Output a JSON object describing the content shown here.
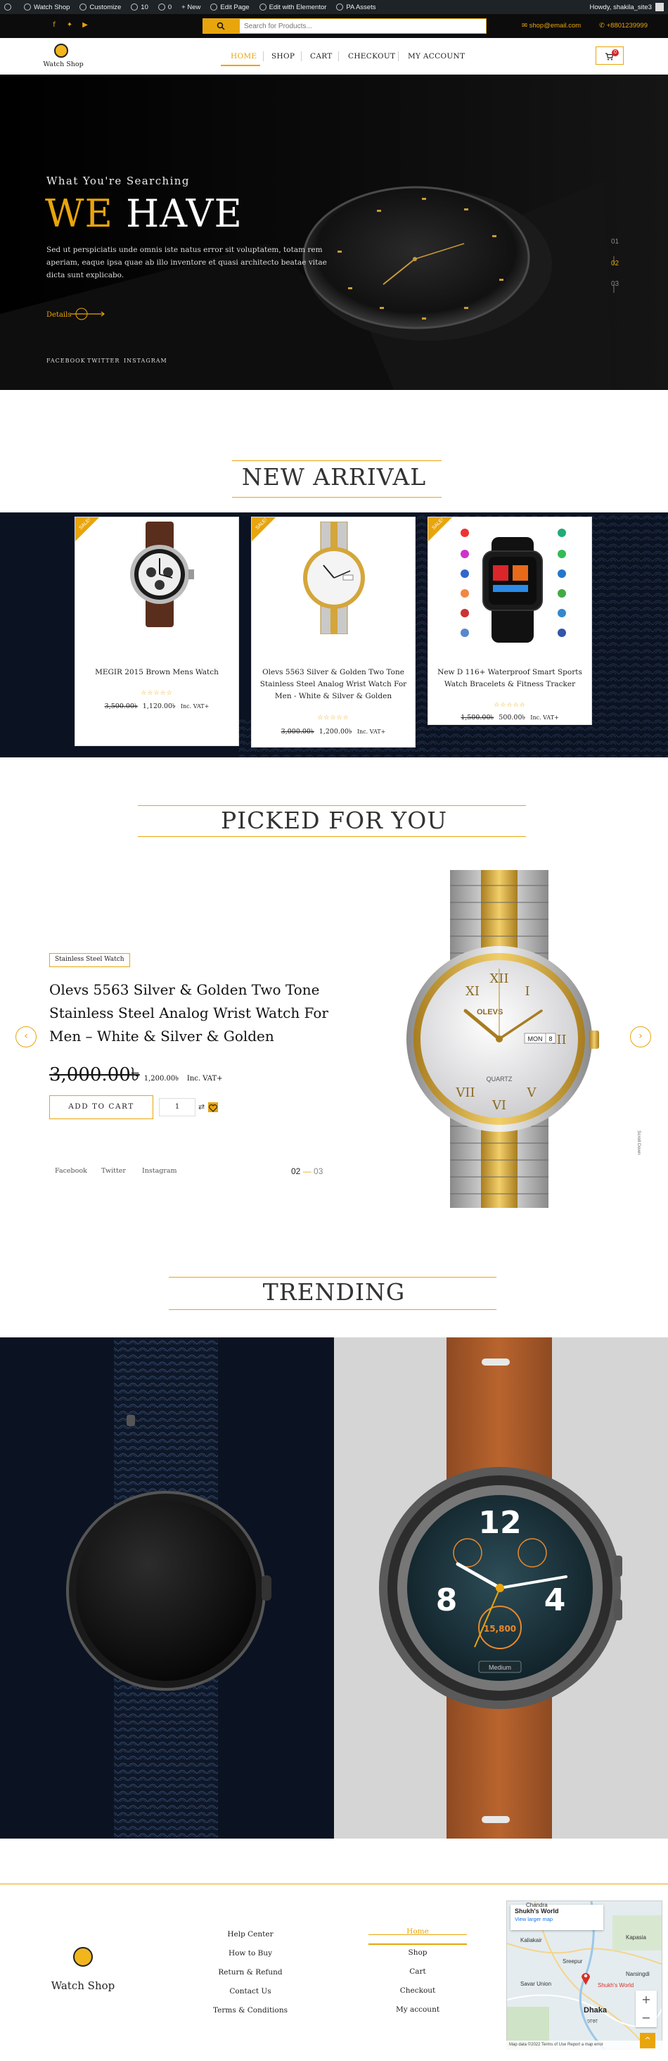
{
  "admin_bar": {
    "site_name": "Watch Shop",
    "customize": "Customize",
    "updates_count": "10",
    "comments_count": "0",
    "new": "+ New",
    "edit_page": "Edit Page",
    "elementor": "Edit with Elementor",
    "pa_assets": "PA Assets",
    "howdy": "Howdy, shakila_site3"
  },
  "topbar": {
    "search_placeholder": "Search for Products...",
    "email": "shop@email.com",
    "phone": "+8801239999"
  },
  "nav": {
    "logo_text": "Watch Shop",
    "items": [
      "HOME",
      "SHOP",
      "CART",
      "CHECKOUT",
      "MY ACCOUNT"
    ],
    "cart_count": "0"
  },
  "hero": {
    "overline": "What You're Searching",
    "title_highlight": "WE",
    "title_rest": "HAVE",
    "description": "Sed ut perspiciatis unde omnis iste natus error sit voluptatem, totam rem aperiam, eaque ipsa quae ab illo inventore et quasi architecto beatae vitae dicta sunt explicabo.",
    "details": "Details",
    "social": [
      "FACEBOOK",
      "TWITTER",
      "INSTAGRAM"
    ],
    "slides": [
      "01",
      "02",
      "03"
    ]
  },
  "new_arrival": {
    "title": "NEW ARRIVAL",
    "badge": "SALE!",
    "products": [
      {
        "name": "MEGIR 2015 Brown Mens Watch",
        "old_price": "3,500.00৳",
        "price": "1,120.00৳",
        "vat": "Inc. VAT+"
      },
      {
        "name": "Olevs 5563 Silver & Golden Two Tone Stainless Steel Analog Wrist Watch For Men - White & Silver & Golden",
        "old_price": "3,000.00৳",
        "price": "1,200.00৳",
        "vat": "Inc. VAT+"
      },
      {
        "name": "New D 116+ Waterproof Smart Sports Watch Bracelets & Fitness Tracker",
        "old_price": "1,500.00৳",
        "price": "500.00৳",
        "vat": "Inc. VAT+"
      }
    ]
  },
  "picked": {
    "title": "PICKED FOR YOU",
    "tag": "Stainless Steel Watch",
    "product_name": "Olevs 5563 Silver & Golden Two Tone Stainless Steel Analog Wrist Watch For Men – White & Silver & Golden",
    "old_price": "3,000.00৳",
    "price": "1,200.00৳",
    "vat": "Inc. VAT+",
    "add_to_cart": "ADD TO CART",
    "qty": "1",
    "social": [
      "Facebook",
      "Twitter",
      "Instagram"
    ],
    "counter_current": "02",
    "counter_dash": "—",
    "counter_total": "03",
    "scroll_down": "Scroll Down",
    "watch_brand": "OLEVS",
    "watch_day": "MON",
    "watch_date": "8",
    "watch_model": "QUARTZ"
  },
  "trending": {
    "title": "TRENDING",
    "watch_distance": "15,800",
    "watch_label": "Medium",
    "watch_numbers": [
      "12",
      "8",
      "4"
    ]
  },
  "footer": {
    "logo_text": "Watch Shop",
    "links": [
      "Help Center",
      "How to Buy",
      "Return & Refund",
      "Contact Us",
      "Terms & Conditions"
    ],
    "links2": [
      "Home",
      "Shop",
      "Cart",
      "Checkout",
      "My account"
    ]
  },
  "map": {
    "place": "Shukh's World",
    "view_larger": "View larger map",
    "labels": [
      "Chandra",
      "Kaliakair",
      "Kapasia",
      "Sreepur",
      "Savar Union",
      "Dhaka",
      "Shukh's World",
      "Narsingdi",
      "ঢাকা"
    ],
    "footer": "Map data ©2022  Terms of Use  Report a map error"
  },
  "colors": {
    "accent": "#e8a50c",
    "dark": "#0b1322",
    "black": "#050505"
  }
}
